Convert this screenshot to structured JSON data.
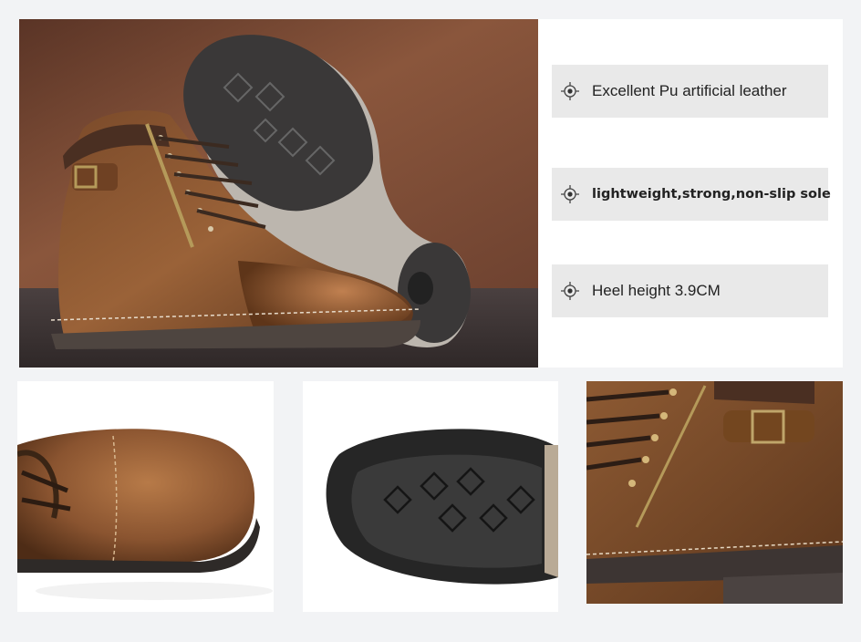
{
  "features": [
    {
      "icon": "crosshair-bullet-icon",
      "label": "Excellent Pu artificial leather"
    },
    {
      "icon": "crosshair-bullet-icon",
      "label": "lightweight,strong,non-slip sole"
    },
    {
      "icon": "crosshair-bullet-icon",
      "label": "Heel height 3.9CM"
    }
  ],
  "colors": {
    "page_background": "#f2f3f5",
    "feature_box": "#e9e9e9",
    "leather": "#8a5430",
    "sole": "#3b3b3b",
    "wall": "#7a4a33"
  }
}
